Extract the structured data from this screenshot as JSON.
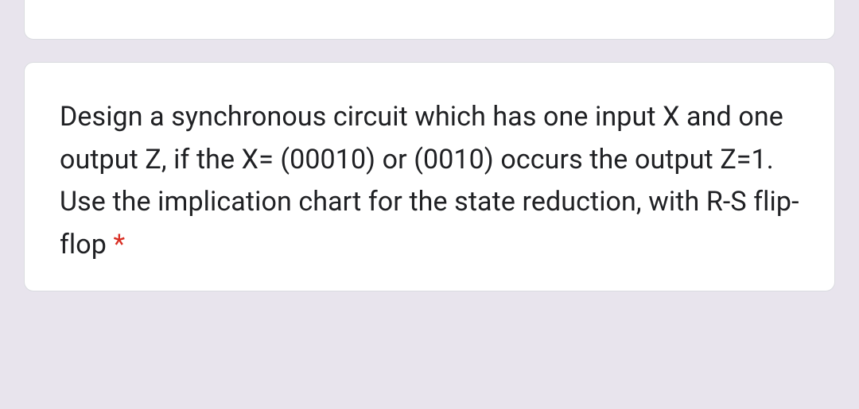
{
  "question": {
    "text": "Design a synchronous circuit which has one input X and one output Z, if the X= (00010) or (0010) occurs the output Z=1. Use the implication chart for the state reduction, with R-S flip-flop ",
    "required_marker": "*"
  }
}
